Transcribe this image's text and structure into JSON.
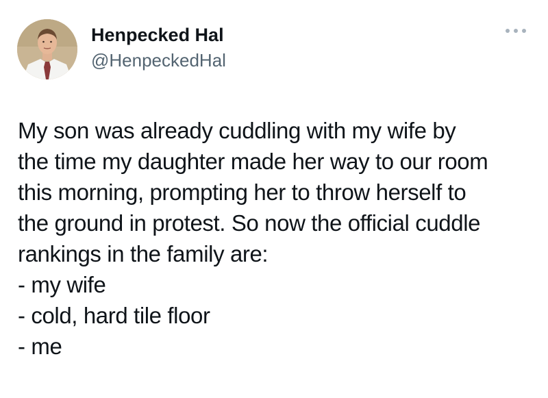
{
  "author": {
    "display_name": "Henpecked Hal",
    "handle": "@HenpeckedHal"
  },
  "more_icon": "more-horizontal-icon",
  "tweet": {
    "lines": [
      "My son was already cuddling with my wife by",
      "the time my daughter made her way to our room",
      "this morning, prompting her to throw herself to",
      "the ground in protest. So now the official cuddle",
      "rankings in the family are:",
      "- my wife",
      "- cold, hard tile floor",
      "- me"
    ]
  },
  "colors": {
    "text": "#0f1419",
    "handle": "#536471",
    "more_dots": "#a8b3bd"
  }
}
